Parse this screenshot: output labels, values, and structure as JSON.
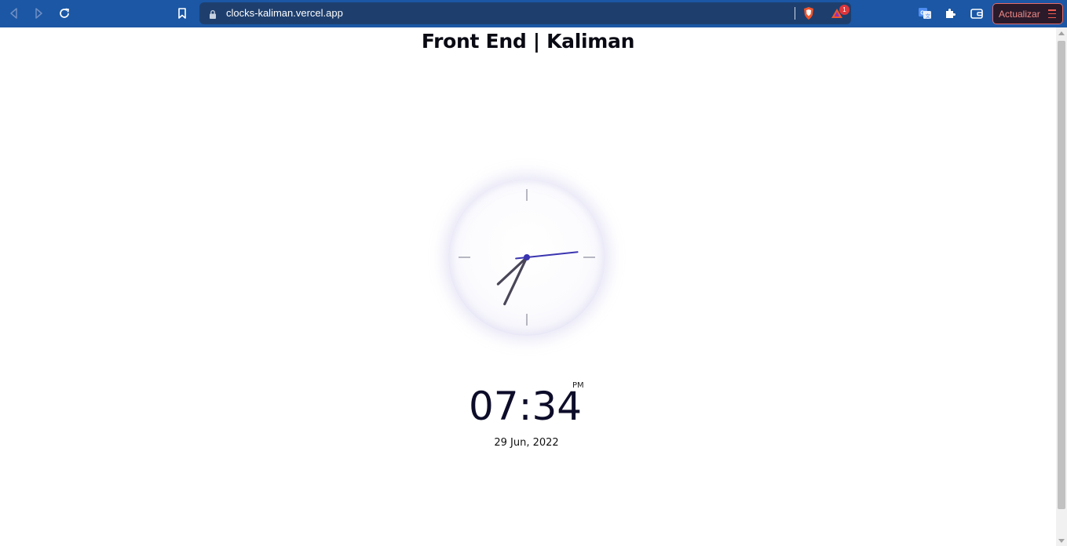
{
  "browser": {
    "url": "clocks-kaliman.vercel.app",
    "notification_count": "1",
    "update_label": "Actualizar",
    "icons": [
      "back-icon",
      "forward-icon",
      "reload-icon",
      "bookmark-icon",
      "lock-icon",
      "brave-shield-icon",
      "brave-rewards-icon",
      "translate-icon",
      "extensions-icon",
      "wallet-icon",
      "menu-icon"
    ],
    "colors": {
      "toolbar": "#1b57a4",
      "urlbar": "#1e3f6e",
      "update_accent": "#e56a67"
    }
  },
  "page": {
    "title": "Front End | Kaliman",
    "time": "07:34",
    "ampm": "PM",
    "date": "29 Jun, 2022"
  },
  "clock": {
    "hour": 7,
    "minute": 34,
    "second": 14,
    "colors": {
      "hands": "#4a4658",
      "second_hand": "#3b35b0",
      "ticks": "#8a8a9a"
    }
  }
}
